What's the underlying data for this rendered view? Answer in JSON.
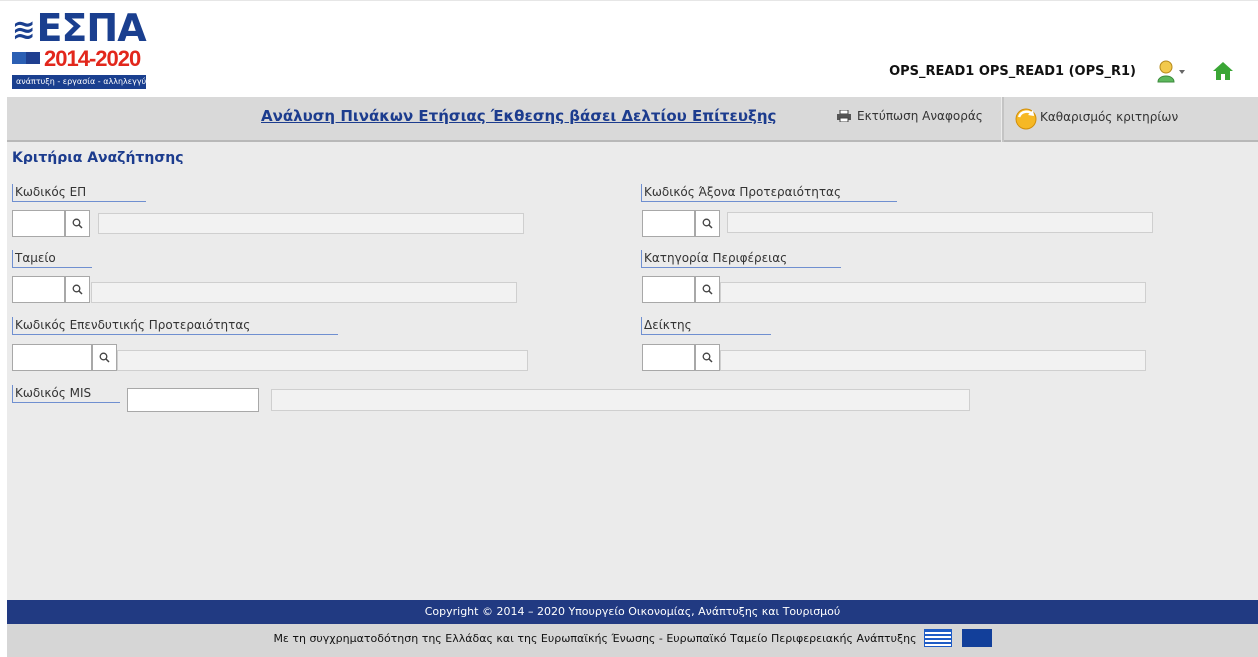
{
  "logo": {
    "brand": "ΕΣΠΑ",
    "years": "2014-2020",
    "slogan": "ανάπτυξη - εργασία - αλληλεγγύη"
  },
  "user": {
    "name": "OPS_READ1 OPS_READ1 (OPS_R1)"
  },
  "titlebar": {
    "title": "Ανάλυση Πινάκων Ετήσιας Έκθεσης βάσει Δελτίου Επίτευξης",
    "print_label": "Εκτύπωση Αναφοράς",
    "clear_label": "Καθαρισμός κριτηρίων"
  },
  "search": {
    "section_title": "Κριτήρια Αναζήτησης",
    "fields": {
      "ep_code": {
        "label": "Κωδικός ΕΠ",
        "value": "",
        "description": ""
      },
      "priority_axis": {
        "label": "Κωδικός Άξονα Προτεραιότητας",
        "value": "",
        "description": ""
      },
      "fund": {
        "label": "Ταμείο",
        "value": "",
        "description": ""
      },
      "region_category": {
        "label": "Κατηγορία Περιφέρειας",
        "value": "",
        "description": ""
      },
      "investment_priority": {
        "label": "Κωδικός Επενδυτικής Προτεραιότητας",
        "value": "",
        "description": ""
      },
      "indicator": {
        "label": "Δείκτης",
        "value": "",
        "description": ""
      },
      "mis_code": {
        "label": "Κωδικός MIS",
        "value": "",
        "description": ""
      }
    }
  },
  "footer": {
    "copyright": "Copyright © 2014 – 2020 Υπουργείο Οικονομίας, Ανάπτυξης και Τουρισμού",
    "cofunding": "Με τη συγχρηματοδότηση της Ελλάδας και της Ευρωπαϊκής Ένωσης - Ευρωπαϊκό Ταμείο Περιφερειακής Ανάπτυξης"
  },
  "colors": {
    "brand_blue": "#1c3c8e",
    "footer_blue": "#213a82",
    "logo_red": "#e2271c"
  },
  "icons": [
    "user-icon",
    "home-icon",
    "print-icon",
    "clear-filter-icon",
    "search-icon",
    "greek-flag-icon",
    "eu-flag-icon"
  ]
}
